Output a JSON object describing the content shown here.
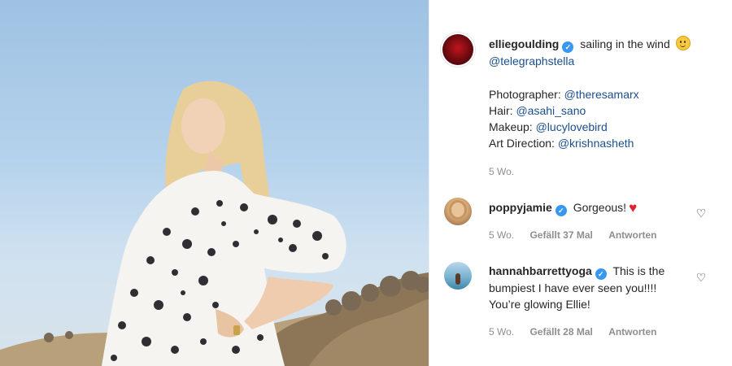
{
  "post": {
    "author": "elliegoulding",
    "caption_text": "sailing in the wind",
    "caption_mention": "@telegraphstella",
    "credits": [
      {
        "label": "Photographer:",
        "handle": "@theresamarx"
      },
      {
        "label": "Hair:",
        "handle": "@asahi_sano"
      },
      {
        "label": "Makeup:",
        "handle": "@lucylovebird"
      },
      {
        "label": "Art Direction:",
        "handle": "@krishnasheth"
      }
    ],
    "age": "5 Wo."
  },
  "comments": [
    {
      "user": "poppyjamie",
      "text": "Gorgeous!",
      "age": "5 Wo.",
      "likes": "Gefällt 37 Mal",
      "reply": "Antworten"
    },
    {
      "user": "hannahbarrettyoga",
      "text_line1": "This is the",
      "text_line2": "bumpiest I have ever seen you!!!!",
      "text_line3": "You’re glowing Ellie!",
      "age": "5 Wo.",
      "likes": "Gefällt 28 Mal",
      "reply": "Antworten"
    }
  ],
  "icons": {
    "verified": "verified-badge-icon",
    "like": "heart-outline-icon",
    "smile": "smiling-face-emoji",
    "heart": "red-heart-emoji"
  },
  "colors": {
    "link": "#1b4f8c",
    "verified": "#3897f0",
    "meta": "#8e8e8e"
  }
}
